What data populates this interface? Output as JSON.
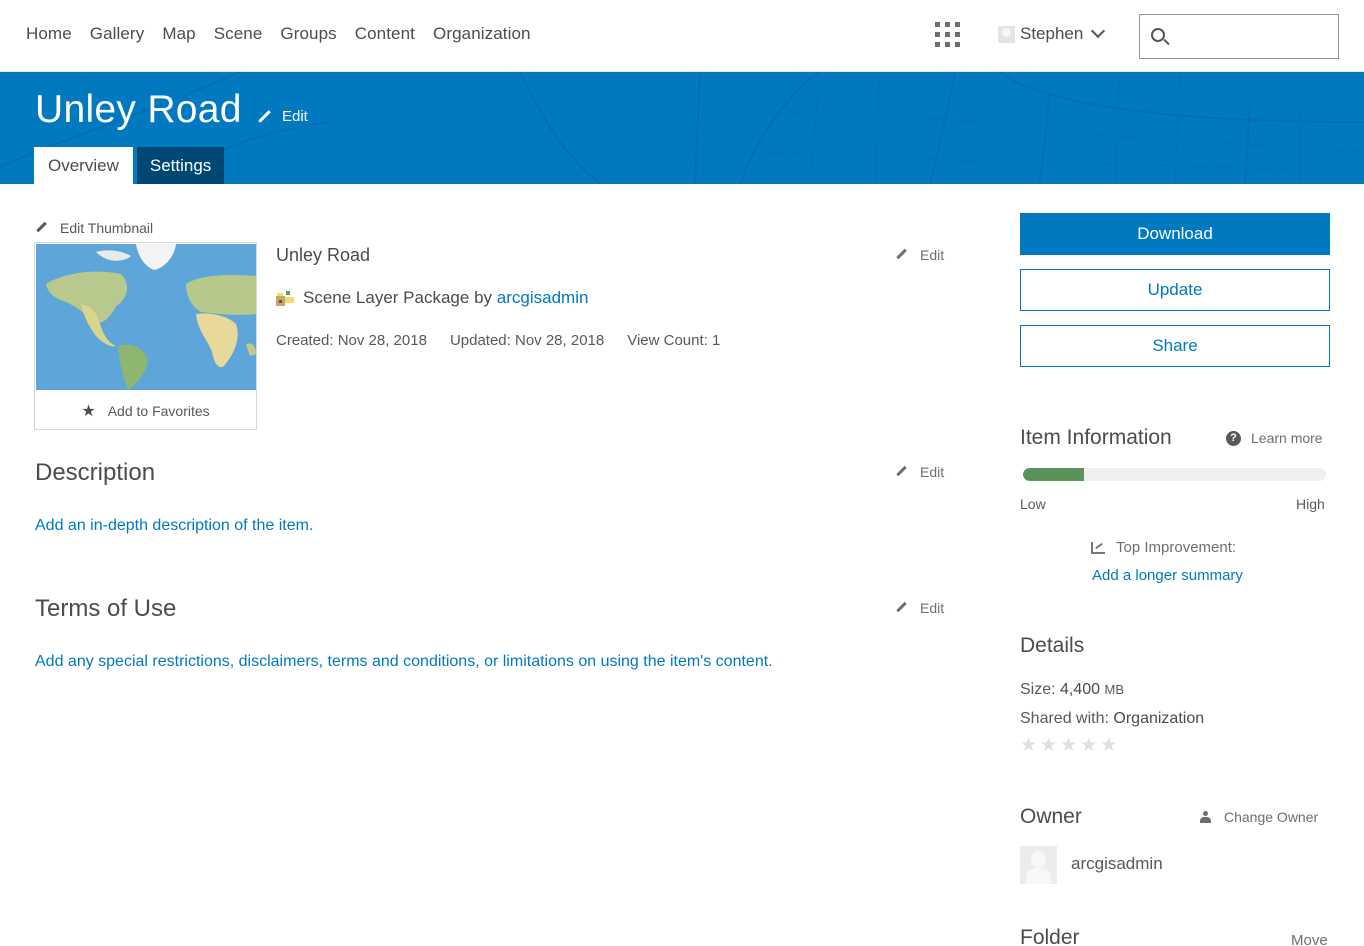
{
  "nav": {
    "links": [
      "Home",
      "Gallery",
      "Map",
      "Scene",
      "Groups",
      "Content",
      "Organization"
    ],
    "apps_icon": "apps-grid-icon",
    "user_name": "Stephen",
    "search": {
      "value": "",
      "placeholder": "",
      "icon": "search-icon"
    }
  },
  "banner": {
    "title": "Unley Road",
    "edit_label": "Edit",
    "tabs": [
      {
        "label": "Overview",
        "active": true
      },
      {
        "label": "Settings",
        "active": false
      }
    ]
  },
  "overview": {
    "edit_thumbnail_label": "Edit Thumbnail",
    "add_to_favorites_label": "Add to Favorites",
    "summary_title": "Unley Road",
    "summary_edit_label": "Edit",
    "item_type": "Scene Layer Package",
    "by_label": "by",
    "owner_link": "arcgisadmin",
    "created": "Created: Nov 28, 2018",
    "updated": "Updated: Nov 28, 2018",
    "view_count": "View Count: 1"
  },
  "description": {
    "heading": "Description",
    "edit_label": "Edit",
    "placeholder_link": "Add an in-depth description of the item."
  },
  "terms": {
    "heading": "Terms of Use",
    "edit_label": "Edit",
    "placeholder_link": "Add any special restrictions, disclaimers, terms and conditions, or limitations on using the item's content."
  },
  "actions": {
    "download": "Download",
    "update": "Update",
    "share": "Share"
  },
  "item_info": {
    "heading": "Item Information",
    "learn_more": "Learn more",
    "score_fraction": 0.2,
    "low_label": "Low",
    "high_label": "High",
    "top_improvement_label": "Top Improvement:",
    "top_improvement_link": "Add a longer summary",
    "colors": {
      "fill": "#5a9359",
      "track": "#efefef"
    }
  },
  "details": {
    "heading": "Details",
    "size_label": "Size:",
    "size_value": "4,400",
    "size_unit": "MB",
    "shared_label": "Shared with:",
    "shared_value": "Organization",
    "rating": 0,
    "rating_max": 5
  },
  "owner": {
    "heading": "Owner",
    "change_owner_label": "Change Owner",
    "name": "arcgisadmin"
  },
  "folder": {
    "heading": "Folder",
    "move_label": "Move"
  },
  "colors": {
    "brand": "#0079c1",
    "tab_inactive": "#004874",
    "text": "#4c4c4c"
  }
}
